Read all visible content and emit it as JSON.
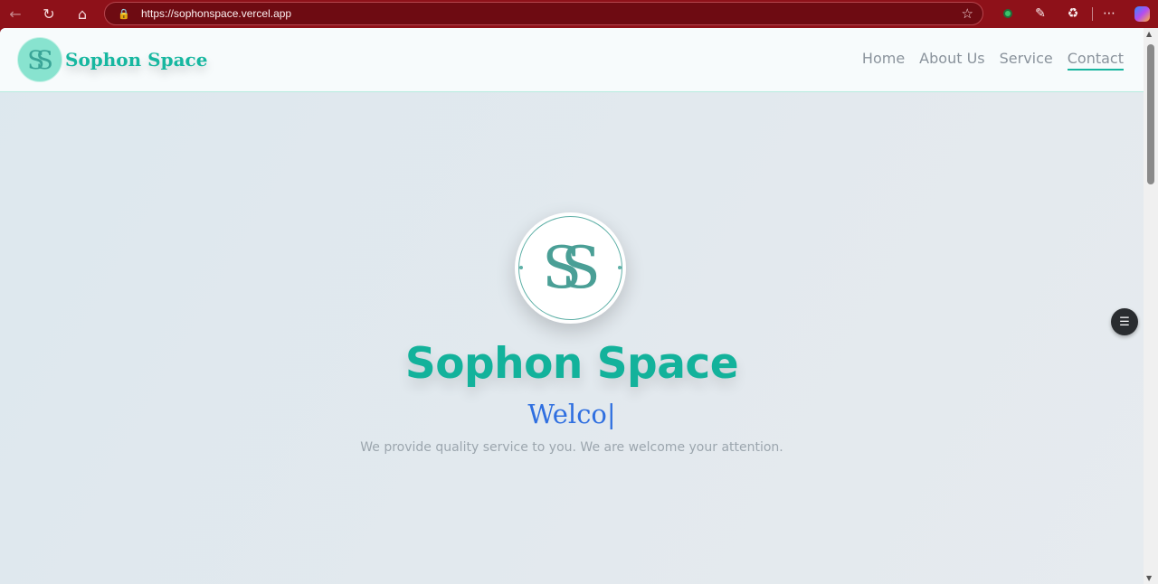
{
  "browser": {
    "url": "https://sophonspace.vercel.app",
    "icons": [
      "back-icon",
      "reload-icon",
      "home-icon",
      "lock-icon",
      "star-icon",
      "extension-icon",
      "pen-icon",
      "puzzle-icon",
      "more-icon",
      "copilot-icon"
    ]
  },
  "header": {
    "logo_mark": "SS",
    "brand": "Sophon Space",
    "nav": [
      {
        "label": "Home"
      },
      {
        "label": "About Us"
      },
      {
        "label": "Service"
      },
      {
        "label": "Contact"
      }
    ],
    "active_nav": "Contact"
  },
  "hero": {
    "logo_mark": "SS",
    "title": "Sophon Space",
    "typed_text": "Welco",
    "caret": "|",
    "subtitle": "We provide quality service to you. We are welcome your attention."
  },
  "colors": {
    "brand_teal": "#13b29b",
    "typed_blue": "#2f6fe0",
    "browser_frame": "#8e1119"
  }
}
